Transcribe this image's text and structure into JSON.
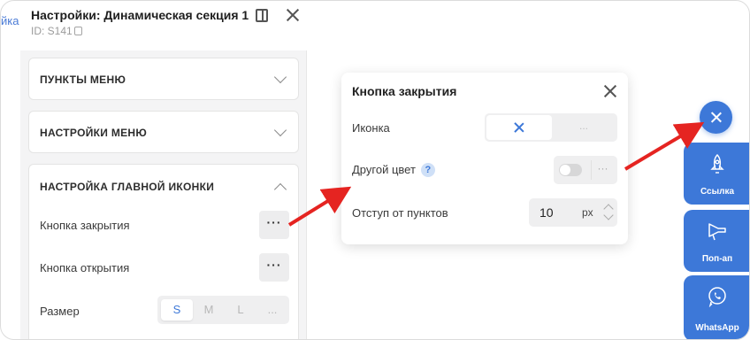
{
  "background": {
    "stub_text": "йка"
  },
  "panel": {
    "title": "Настройки: Динамическая секция 1",
    "id_label": "ID: S141",
    "sections": {
      "menu_items": "ПУНКТЫ МЕНЮ",
      "menu_settings": "НАСТРОЙКИ МЕНЮ",
      "main_icon": "НАСТРОЙКА ГЛАВНОЙ ИКОНКИ"
    },
    "rows": {
      "close_button": "Кнопка закрытия",
      "open_button": "Кнопка открытия",
      "size": "Размер",
      "dots": "···"
    },
    "size_options": [
      "S",
      "M",
      "L",
      "..."
    ],
    "size_selected": "S"
  },
  "popup": {
    "title": "Кнопка закрытия",
    "icon_label": "Иконка",
    "icon_more": "...",
    "other_color_label": "Другой цвет",
    "help_glyph": "?",
    "other_color_on": false,
    "toggle_more": "···",
    "offset_label": "Отступ от пунктов",
    "offset_value": "10",
    "offset_unit": "px"
  },
  "widget": {
    "accent": "#3d78d8",
    "tiles": [
      {
        "label": "Ссылка",
        "icon": "rocket-icon"
      },
      {
        "label": "Поп-ап",
        "icon": "megaphone-icon"
      },
      {
        "label": "WhatsApp",
        "icon": "whatsapp-icon"
      }
    ]
  },
  "colors": {
    "arrow": "#e52421",
    "accent": "#3d78d8"
  }
}
